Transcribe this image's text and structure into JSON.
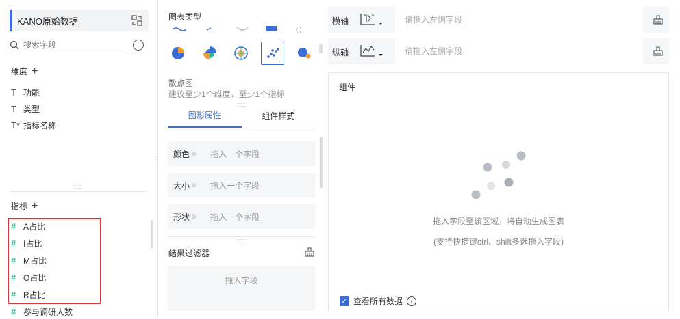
{
  "datasource": {
    "name": "KANO原始数据"
  },
  "search": {
    "placeholder": "搜索字段"
  },
  "more_icon": "ellipsis-icon",
  "dimensions": {
    "title": "维度",
    "items": [
      {
        "label": "功能",
        "icon": "T"
      },
      {
        "label": "类型",
        "icon": "T"
      },
      {
        "label": "指标名称",
        "icon": "T*"
      }
    ]
  },
  "metrics": {
    "title": "指标",
    "items": [
      {
        "label": "A占比",
        "icon": "#"
      },
      {
        "label": "I占比",
        "icon": "#"
      },
      {
        "label": "M占比",
        "icon": "#"
      },
      {
        "label": "O占比",
        "icon": "#"
      },
      {
        "label": "R占比",
        "icon": "#"
      },
      {
        "label": "参与调研人数",
        "icon": "#"
      }
    ]
  },
  "chart_types": {
    "title": "图表类型",
    "selected_name": "散点图",
    "selected_hint": "建议至少1个维度，至少1个指标",
    "icons": [
      "pie-chart-icon",
      "rose-chart-icon",
      "radar-chart-icon",
      "scatter-chart-icon",
      "bubble-chart-icon"
    ]
  },
  "tabs": [
    {
      "label": "图形属性",
      "active": true
    },
    {
      "label": "组件样式",
      "active": false
    }
  ],
  "properties": [
    {
      "label": "颜色",
      "placeholder": "拖入一个字段"
    },
    {
      "label": "大小",
      "placeholder": "拖入一个字段"
    },
    {
      "label": "形状",
      "placeholder": "拖入一个字段"
    }
  ],
  "filter": {
    "title": "结果过滤器",
    "placeholder": "拖入字段"
  },
  "axes": {
    "x": {
      "label": "横轴",
      "placeholder": "请拖入左侧字段"
    },
    "y": {
      "label": "纵轴",
      "placeholder": "请拖入左侧字段"
    }
  },
  "component": {
    "title": "组件",
    "message": "拖入字段至该区域，将自动生成图表",
    "hint": "(支持快捷键ctrl、shift多选拖入字段)",
    "view_all_label": "查看所有数据",
    "view_all_checked": true
  },
  "colors": {
    "accent": "#3b6dd6",
    "highlight": "#dd3333",
    "metric_icon": "#2fb59a"
  }
}
